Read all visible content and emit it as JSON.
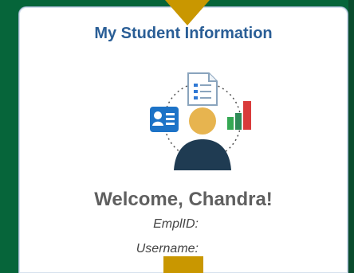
{
  "tile": {
    "title": "My Student Information",
    "welcome": "Welcome, Chandra!",
    "emplid_label": "EmplID:",
    "emplid_value": "",
    "username_label": "Username:",
    "username_value": ""
  },
  "icons": {
    "document": "document-list-icon",
    "id_card": "id-card-icon",
    "chart": "bar-chart-icon",
    "person": "person-avatar-icon"
  },
  "colors": {
    "background": "#06653a",
    "tile_title": "#2a5e96",
    "focus_accent": "#c99700",
    "welcome_text": "#5f5f5f"
  }
}
